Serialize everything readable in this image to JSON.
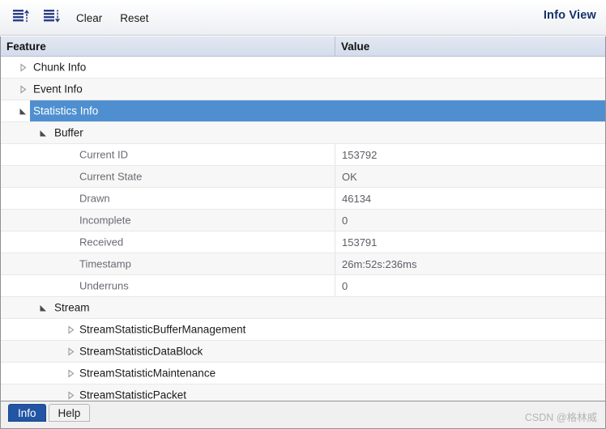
{
  "toolbar": {
    "buttons": [
      {
        "name": "collapse-all-icon",
        "label": "",
        "icon": "lines-up-arrow"
      },
      {
        "name": "expand-all-icon",
        "label": "",
        "icon": "lines-down-arrow"
      }
    ],
    "clear_label": "Clear",
    "reset_label": "Reset",
    "title": "Info View"
  },
  "table": {
    "columns": {
      "feature": "Feature",
      "value": "Value"
    },
    "rows": [
      {
        "label": "Chunk Info",
        "value": "",
        "indent": 1,
        "twisty": "collapsed",
        "kind": "group",
        "selected": false,
        "stripe": "plain"
      },
      {
        "label": "Event Info",
        "value": "",
        "indent": 1,
        "twisty": "collapsed",
        "kind": "group",
        "selected": false,
        "stripe": "alt"
      },
      {
        "label": "Statistics Info",
        "value": "",
        "indent": 1,
        "twisty": "expanded",
        "kind": "group",
        "selected": true,
        "stripe": "plain"
      },
      {
        "label": "Buffer",
        "value": "",
        "indent": 2,
        "twisty": "expanded",
        "kind": "group",
        "selected": false,
        "stripe": "alt"
      },
      {
        "label": "Current ID",
        "value": "153792",
        "indent": 3,
        "twisty": "none",
        "kind": "leaf",
        "selected": false,
        "stripe": "plain"
      },
      {
        "label": "Current State",
        "value": "OK",
        "indent": 3,
        "twisty": "none",
        "kind": "leaf",
        "selected": false,
        "stripe": "alt"
      },
      {
        "label": "Drawn",
        "value": "46134",
        "indent": 3,
        "twisty": "none",
        "kind": "leaf",
        "selected": false,
        "stripe": "plain"
      },
      {
        "label": "Incomplete",
        "value": "0",
        "indent": 3,
        "twisty": "none",
        "kind": "leaf",
        "selected": false,
        "stripe": "alt"
      },
      {
        "label": "Received",
        "value": "153791",
        "indent": 3,
        "twisty": "none",
        "kind": "leaf",
        "selected": false,
        "stripe": "plain"
      },
      {
        "label": "Timestamp",
        "value": "26m:52s:236ms",
        "indent": 3,
        "twisty": "none",
        "kind": "leaf",
        "selected": false,
        "stripe": "alt"
      },
      {
        "label": "Underruns",
        "value": "0",
        "indent": 3,
        "twisty": "none",
        "kind": "leaf",
        "selected": false,
        "stripe": "plain"
      },
      {
        "label": "Stream",
        "value": "",
        "indent": 2,
        "twisty": "expanded",
        "kind": "group",
        "selected": false,
        "stripe": "alt"
      },
      {
        "label": "StreamStatisticBufferManagement",
        "value": "",
        "indent": 3,
        "twisty": "collapsed",
        "kind": "group",
        "selected": false,
        "stripe": "plain"
      },
      {
        "label": "StreamStatisticDataBlock",
        "value": "",
        "indent": 3,
        "twisty": "collapsed",
        "kind": "group",
        "selected": false,
        "stripe": "alt"
      },
      {
        "label": "StreamStatisticMaintenance",
        "value": "",
        "indent": 3,
        "twisty": "collapsed",
        "kind": "group",
        "selected": false,
        "stripe": "plain"
      },
      {
        "label": "StreamStatisticPacket",
        "value": "",
        "indent": 3,
        "twisty": "collapsed",
        "kind": "group",
        "selected": false,
        "stripe": "alt"
      }
    ]
  },
  "tabs": [
    {
      "label": "Info",
      "active": true
    },
    {
      "label": "Help",
      "active": false
    }
  ],
  "watermark": "CSDN @格林威",
  "colors": {
    "selection_blue": "#4f8fd0",
    "active_tab_blue": "#2255a4",
    "title_navy": "#15306b",
    "icon_blue": "#2b3f87",
    "leaf_text": "#6a6a73"
  }
}
